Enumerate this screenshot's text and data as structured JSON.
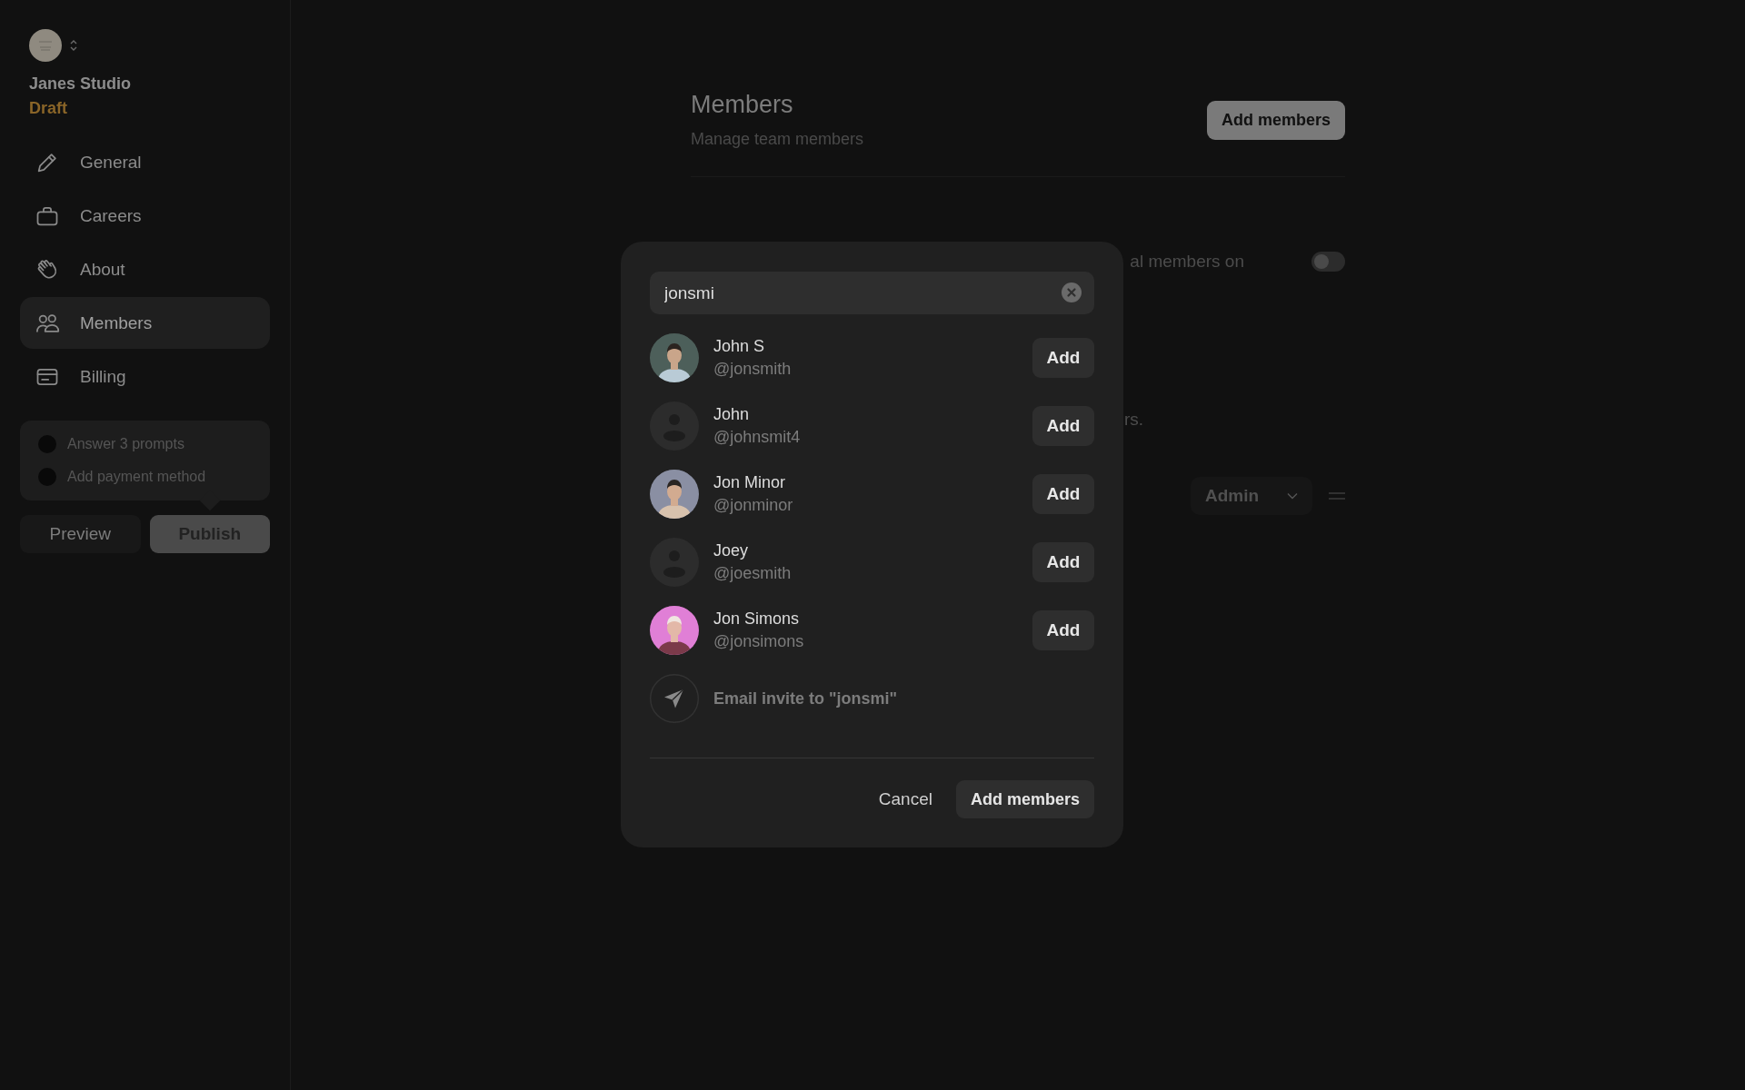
{
  "workspace": {
    "name": "Janes Studio",
    "status": "Draft"
  },
  "nav": [
    {
      "label": "General",
      "selected": false
    },
    {
      "label": "Careers",
      "selected": false
    },
    {
      "label": "About",
      "selected": false
    },
    {
      "label": "Members",
      "selected": true
    },
    {
      "label": "Billing",
      "selected": false
    }
  ],
  "checklist": [
    {
      "label": "Answer 3 prompts",
      "checked": false
    },
    {
      "label": "Add payment method",
      "checked": false
    }
  ],
  "sidebar_buttons": {
    "preview": "Preview",
    "publish": "Publish"
  },
  "page": {
    "title": "Members",
    "subtitle": "Manage team members",
    "add_button": "Add members",
    "setting_fragment": "al members on",
    "toggle_on": false,
    "note_fragment": "rs.",
    "role": "Admin"
  },
  "dialog": {
    "search_value": "jonsmi",
    "results": [
      {
        "name": "John S",
        "handle": "@jonsmith",
        "kind": "picture",
        "action": "Add"
      },
      {
        "name": "John",
        "handle": "@johnsmit4",
        "kind": "placeholder",
        "action": "Add"
      },
      {
        "name": "Jon Minor",
        "handle": "@jonminor",
        "kind": "picture",
        "action": "Add"
      },
      {
        "name": "Joey",
        "handle": "@joesmith",
        "kind": "placeholder",
        "action": "Add"
      },
      {
        "name": "Jon Simons",
        "handle": "@jonsimons",
        "kind": "picture",
        "action": "Add"
      }
    ],
    "email_invite": "Email invite to \"jonsmi\"",
    "cancel": "Cancel",
    "confirm": "Add members"
  }
}
